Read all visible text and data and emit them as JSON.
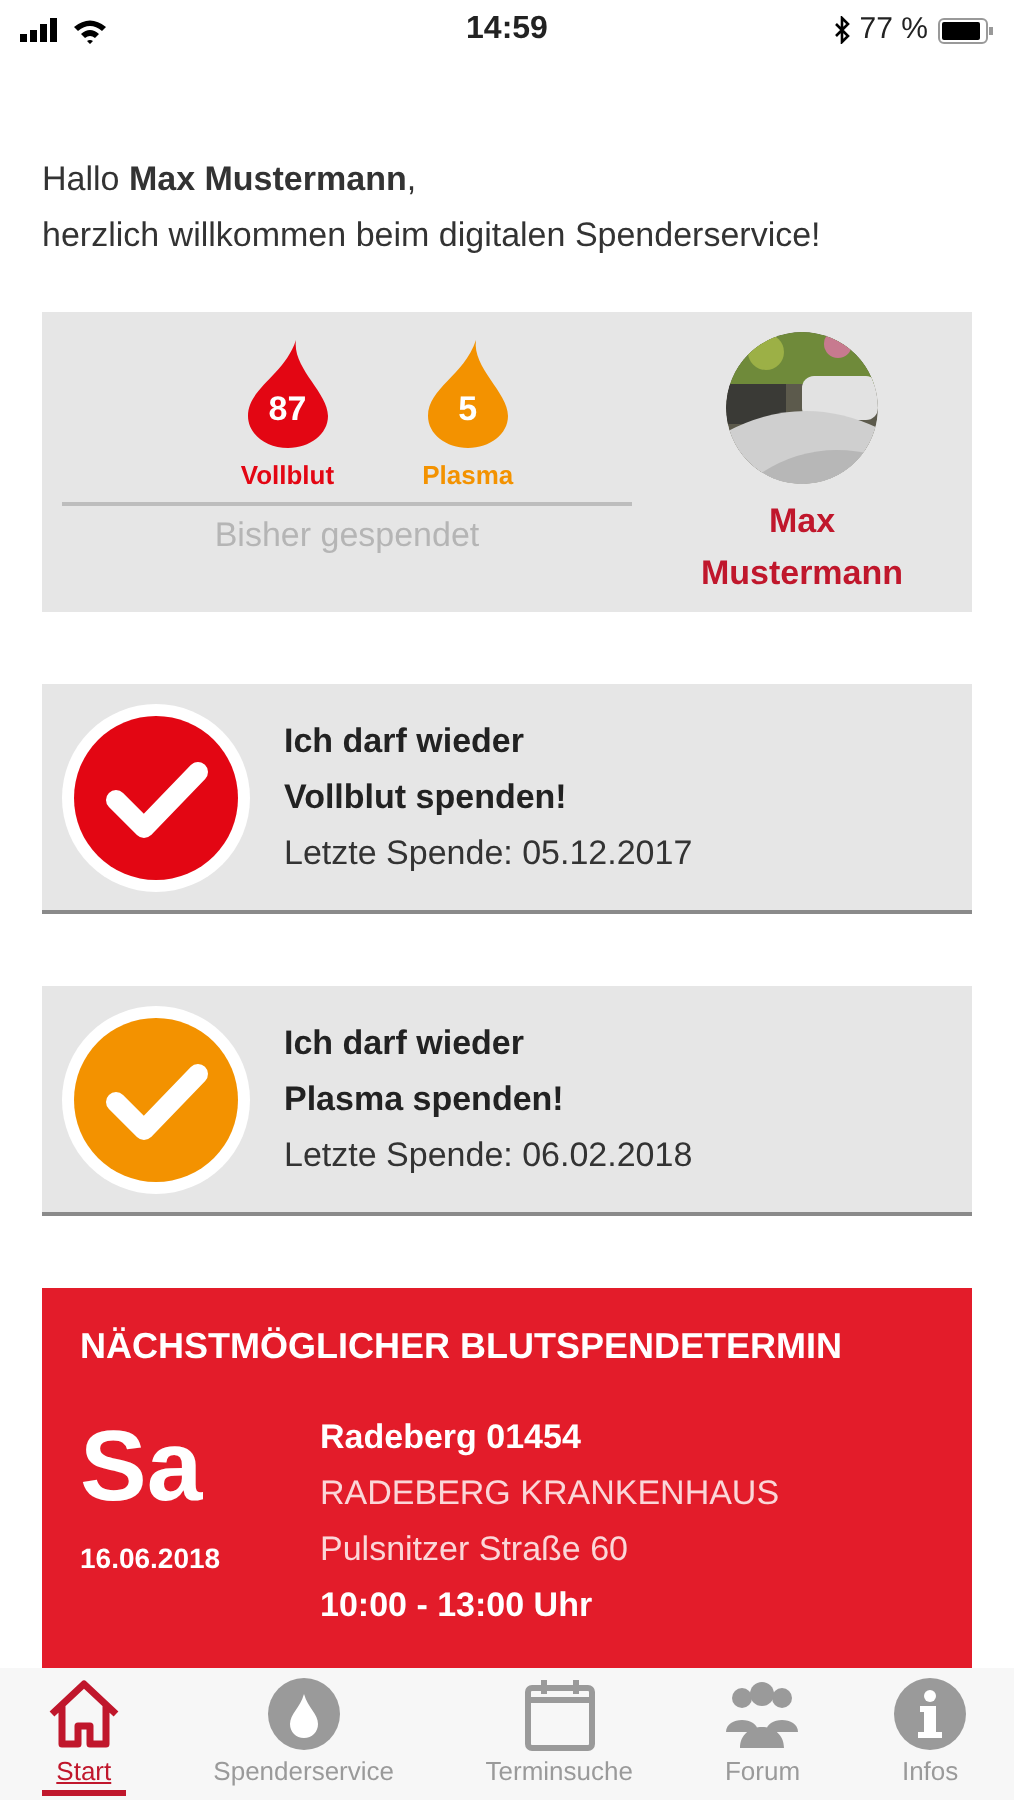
{
  "status_bar": {
    "time": "14:59",
    "battery": "77 %"
  },
  "greeting": {
    "line1": "Hallo **Max Mustermann**,",
    "line2": "herzlich willkommen beim digitalen Spenderservice!"
  },
  "donations": {
    "counts": [
      {
        "value": "87",
        "label": "Vollblut",
        "color": "#e30613"
      },
      {
        "value": "5",
        "label": "Plasma",
        "color": "#f39200"
      }
    ],
    "caption": "Bisher gespendet",
    "profile": {
      "name": "Max Mustermann"
    }
  },
  "eligibility": [
    {
      "line1": "Ich darf wieder",
      "line2": "Vollblut spenden!",
      "last": "Letzte Spende: 05.12.2017",
      "color": "#e30613"
    },
    {
      "line1": "Ich darf wieder",
      "line2": "Plasma spenden!",
      "last": "Letzte Spende: 06.02.2018",
      "color": "#f39200"
    }
  ],
  "next_appointment": {
    "title": "NÄCHSTMÖGLICHER BLUTSPENDETERMIN",
    "weekday": "Sa",
    "date": "16.06.2018",
    "city": "Radeberg 01454",
    "place": "RADEBERG KRANKENHAUS",
    "street": "Pulsnitzer Straße 60",
    "time": "10:00 - 13:00 Uhr"
  },
  "tabs": [
    {
      "kind": "home",
      "label": "Start",
      "selected": true
    },
    {
      "kind": "drop",
      "label": "Spenderservice",
      "selected": false
    },
    {
      "kind": "calendar",
      "label": "Terminsuche",
      "selected": false
    },
    {
      "kind": "people",
      "label": "Forum",
      "selected": false
    },
    {
      "kind": "info",
      "label": "Infos",
      "selected": false
    }
  ]
}
